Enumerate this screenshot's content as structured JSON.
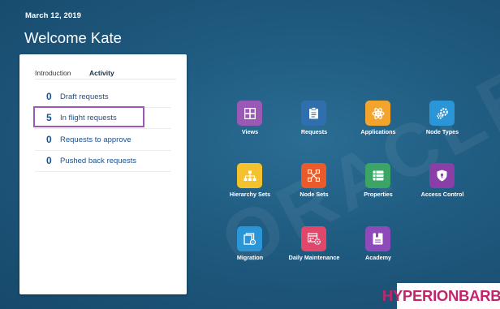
{
  "header": {
    "date": "March 12, 2019",
    "welcome": "Welcome Kate"
  },
  "watermark": {
    "text": "ORACLE"
  },
  "panel": {
    "tabs": [
      {
        "label": "Introduction"
      },
      {
        "label": "Activity"
      }
    ],
    "active_tab": "Activity",
    "stats": [
      {
        "count": "0",
        "label": "Draft requests"
      },
      {
        "count": "5",
        "label": "In flight requests"
      },
      {
        "count": "0",
        "label": "Requests to approve"
      },
      {
        "count": "0",
        "label": "Pushed back requests"
      }
    ],
    "highlight_color": "#9d57b4"
  },
  "tiles": [
    {
      "label": "Views",
      "icon": "grid-icon",
      "color": "#9b59b6"
    },
    {
      "label": "Requests",
      "icon": "clipboard-icon",
      "color": "#2f6fad"
    },
    {
      "label": "Applications",
      "icon": "atom-icon",
      "color": "#f3a42c"
    },
    {
      "label": "Node Types",
      "icon": "gears-icon",
      "color": "#2a96d8"
    },
    {
      "label": "Hierarchy Sets",
      "icon": "hierarchy-icon",
      "color": "#f3c22c"
    },
    {
      "label": "Node Sets",
      "icon": "nodes-icon",
      "color": "#ea5a2a"
    },
    {
      "label": "Properties",
      "icon": "list-icon",
      "color": "#3aa564"
    },
    {
      "label": "Access Control",
      "icon": "shield-icon",
      "color": "#8a3fa8"
    },
    {
      "label": "Migration",
      "icon": "migration-icon",
      "color": "#2a96d8"
    },
    {
      "label": "Daily Maintenance",
      "icon": "maintenance-icon",
      "color": "#e0476b"
    },
    {
      "label": "Academy",
      "icon": "academy-icon",
      "color": "#8e4ab8"
    }
  ],
  "brand": {
    "text": "HYPERIONBARBIE",
    "color": "#c1266d"
  }
}
